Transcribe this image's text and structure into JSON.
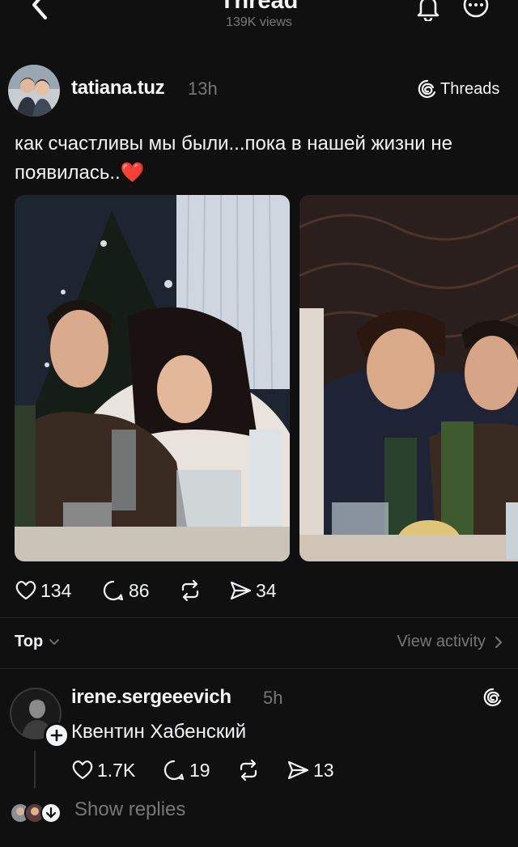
{
  "header": {
    "title": "Thread",
    "views": "139K views"
  },
  "post": {
    "username": "tatiana.tuz",
    "time": "13h",
    "app_label": "Threads",
    "text": "как счастливы мы были...пока в нашей жизни не появилась..❤️",
    "likes": "134",
    "comments": "86",
    "shares": "34"
  },
  "sort": {
    "label": "Top",
    "view_activity": "View activity"
  },
  "reply": {
    "username": "irene.sergeeevich",
    "time": "5h",
    "text": "Квентин Хабенский",
    "likes": "1.7K",
    "comments": "19",
    "shares": "13",
    "show_replies": "Show replies"
  },
  "colors": {
    "background": "#101010",
    "text": "#f3f5f7",
    "muted": "#777777",
    "heart": "#e0245e"
  },
  "icons": [
    "back-icon",
    "bell-icon",
    "more-icon",
    "threads-logo-icon",
    "heart-icon",
    "comment-icon",
    "repost-icon",
    "share-icon",
    "chevron-down-icon",
    "chevron-right-icon",
    "plus-icon"
  ]
}
